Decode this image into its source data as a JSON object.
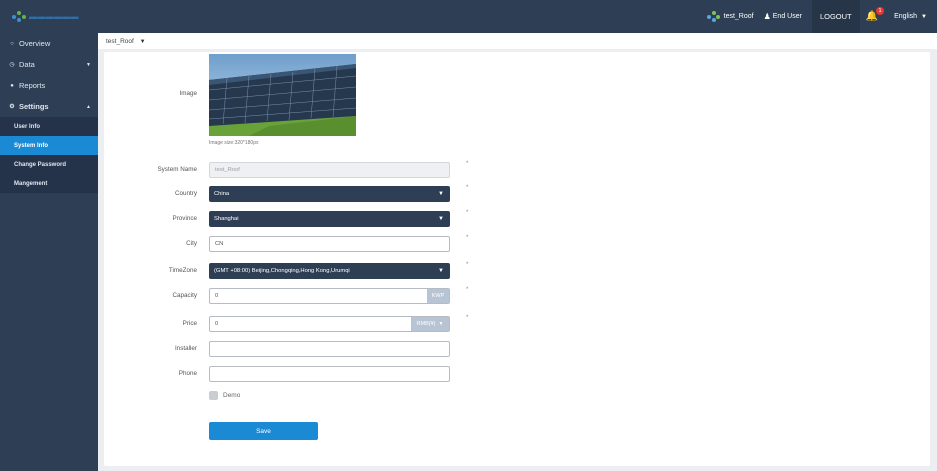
{
  "header": {
    "system_name": "test_Roof",
    "user_role": "End User",
    "logout_label": "LOGOUT",
    "notification_count": "1",
    "language": "English",
    "accent_color": "#1a8ad4",
    "bar_color": "#2e3f55"
  },
  "sidebar": {
    "items": [
      {
        "label": "Overview",
        "icon": "circle-icon"
      },
      {
        "label": "Data",
        "icon": "clock-icon"
      },
      {
        "label": "Reports",
        "icon": "report-icon"
      },
      {
        "label": "Settings",
        "icon": "gear-icon"
      }
    ],
    "settings_sub": [
      {
        "label": "User Info"
      },
      {
        "label": "System Info",
        "active": true
      },
      {
        "label": "Change Password"
      },
      {
        "label": "Mangement"
      }
    ]
  },
  "breadcrumb": {
    "current": "test_Roof"
  },
  "form": {
    "image": {
      "label": "Image",
      "hint": "Image size:320*180px"
    },
    "system_name": {
      "label": "System Name",
      "value": "test_Roof",
      "required": "*"
    },
    "country": {
      "label": "Country",
      "value": "China",
      "required": "*"
    },
    "province": {
      "label": "Province",
      "value": "Shanghai",
      "required": "*"
    },
    "city": {
      "label": "City",
      "value": "CN",
      "required": "*"
    },
    "timezone": {
      "label": "TimeZone",
      "value": "(GMT +08:00) Beijing,Chongqing,Hong Kong,Urumqi",
      "required": "*"
    },
    "capacity": {
      "label": "Capacity",
      "value": "0",
      "unit": "KWP",
      "required": "*"
    },
    "price": {
      "label": "Price",
      "value": "0",
      "unit": "RMB(¥)",
      "required": "*"
    },
    "installer": {
      "label": "Installer",
      "value": ""
    },
    "phone": {
      "label": "Phone",
      "value": ""
    },
    "demo": {
      "label": "Demo"
    },
    "save_label": "Save"
  }
}
